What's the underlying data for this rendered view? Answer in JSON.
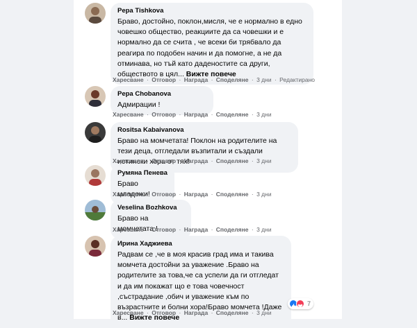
{
  "actions": {
    "like": "Харесване",
    "reply": "Отговор",
    "award": "Награда",
    "share": "Споделяне",
    "dot": "·"
  },
  "comments": [
    {
      "author": "Pepa Tishkova",
      "text": "Браво, достойно, поклон,мисля, че е нормално в едно човешко общество, реакциите да са човешки и е нормално да се счита , че всеки би трябвало да реагира по подобен начин и да помогне, а не да отминава, но тъй като даденостите са други, обществото в цял...",
      "more": "Вижте повече",
      "time": "3 дни",
      "edited": "Редактирано"
    },
    {
      "author": "Pepa Chobanova",
      "text": "Адмирации !",
      "time": "3 дни"
    },
    {
      "author": "Rositsa Kabaivanova",
      "text": "Браво на момчетата! Поклон на родителите на тези деца, отгледали възпитали и създали истински хора от тях!",
      "time": "3 дни"
    },
    {
      "author": "Румяна Пенева",
      "text": "Браво младежи!",
      "time": "3 дни"
    },
    {
      "author": "Veselina Bozhkova",
      "text": "Браво на момчетата !",
      "time": "3 дни"
    },
    {
      "author": "Ирина Хаджиева",
      "text": "Радвам се ,че в моя красив град има и такива момчета достойни за уважение .Браво на родителите за това,че са успели да ги отгледат и да им покажат що е това човечност ,състрадание ,обич и уважение към по възрастните и болни хора!Браво момчета !Даже в...",
      "more": "Вижте повече",
      "time": "3 дни",
      "reactions": {
        "count": "7"
      }
    }
  ],
  "colors": {
    "page_bg": "#f0f2f5",
    "bubble_bg": "#f0f2f5",
    "meta_text": "#65676b",
    "like_blue": "#1877f2",
    "love_red": "#f33e58"
  }
}
